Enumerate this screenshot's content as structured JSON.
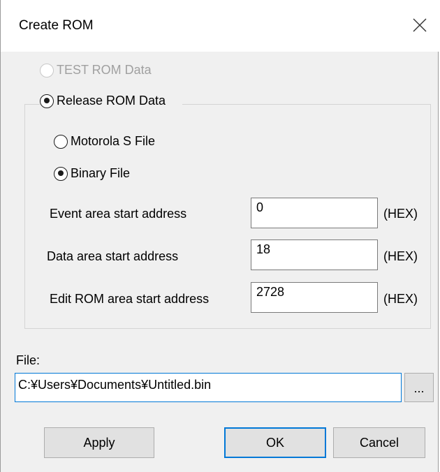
{
  "window": {
    "title": "Create ROM"
  },
  "rom_type": {
    "test_label": "TEST ROM Data",
    "release_label": "Release ROM Data",
    "selected": "release"
  },
  "file_format": {
    "motorola_label": "Motorola S File",
    "binary_label": "Binary File",
    "selected": "binary"
  },
  "addresses": {
    "event": {
      "label": "Event area start address",
      "value": "0",
      "unit": "(HEX)"
    },
    "data": {
      "label": "Data area start address",
      "value": "18",
      "unit": "(HEX)"
    },
    "edit_rom": {
      "label": "Edit ROM area start address",
      "value": "2728",
      "unit": "(HEX)"
    }
  },
  "file": {
    "label": "File:",
    "path": "C:¥Users¥Documents¥Untitled.bin",
    "browse_label": "..."
  },
  "buttons": {
    "apply": "Apply",
    "ok": "OK",
    "cancel": "Cancel"
  },
  "icons": {
    "close": "close-icon"
  }
}
